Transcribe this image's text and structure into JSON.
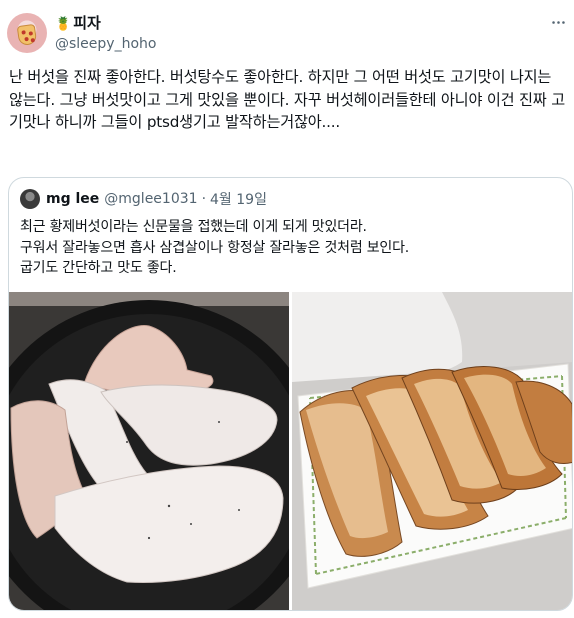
{
  "tweet": {
    "author": {
      "emoji": "🍍",
      "display_name": "피자",
      "handle": "@sleepy_hoho",
      "avatar_icon": "pizza-avatar-icon"
    },
    "text": "난 버섯을 진짜 좋아한다. 버섯탕수도 좋아한다. 하지만 그 어떤 버섯도 고기맛이 나지는 않는다. 그냥 버섯맛이고 그게 맛있을 뿐이다. 자꾸 버섯헤이러들한테 아니야 이건 진짜 고기맛나 하니까 그들이 ptsd생기고 발작하는거잖아....",
    "more_icon": "more-options-icon"
  },
  "quoted": {
    "author": {
      "display_name": "mg lee",
      "handle": "@mglee1031",
      "separator": "·",
      "date": "4월 19일"
    },
    "lines": [
      "최근 황제버섯이라는 신문물을 접했는데 이게 되게 맛있더라.",
      "구워서 잘라놓으면 흡사 삼겹살이나 항정살 잘라놓은 것처럼 보인다.",
      "굽기도 간단하고 맛도 좋다."
    ]
  },
  "colors": {
    "text": "#0f1419",
    "secondary": "#536471",
    "border": "#cfd9de"
  }
}
